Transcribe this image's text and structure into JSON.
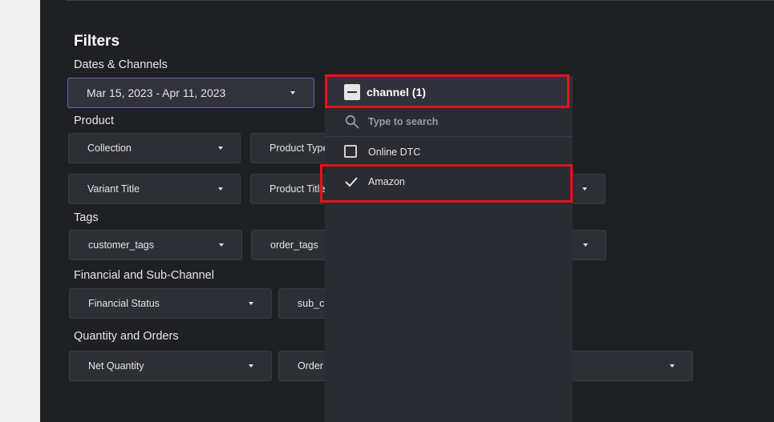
{
  "filters": {
    "title": "Filters",
    "sections": {
      "dates_channels": "Dates & Channels",
      "product": "Product",
      "tags": "Tags",
      "financial": "Financial and Sub-Channel",
      "quantity": "Quantity and Orders"
    },
    "date_range": "Mar 15, 2023 - Apr 11, 2023",
    "dropdowns": {
      "collection": "Collection",
      "product_type": "Product Type",
      "variant_title": "Variant Title",
      "product_title": "Product Title",
      "customer_tags": "customer_tags",
      "order_tags": "order_tags",
      "financial_status": "Financial Status",
      "sub_channel": "sub_cl",
      "net_quantity": "Net Quantity",
      "orders": "Order"
    }
  },
  "channel_popup": {
    "header": "channel (1)",
    "search_placeholder": "Type to search",
    "options": [
      {
        "label": "Online DTC",
        "checked": false
      },
      {
        "label": "Amazon",
        "checked": true
      }
    ]
  },
  "colors": {
    "panel_bg": "#1f2024",
    "dropdown_bg": "#2d2f35",
    "date_border": "#6d65b5",
    "highlight": "#e0141b"
  },
  "icons": [
    "minus-checkbox-icon",
    "search-icon",
    "checkbox-icon",
    "checkmark-icon",
    "chevron-down-icon"
  ]
}
